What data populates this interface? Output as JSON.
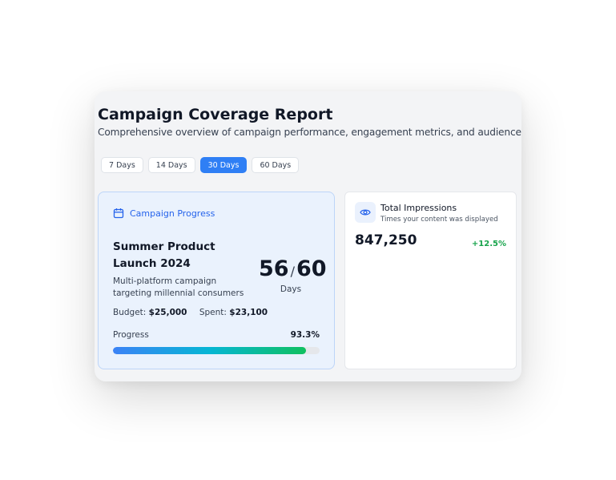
{
  "header": {
    "title": "Campaign Coverage Report",
    "subtitle": "Comprehensive overview of campaign performance, engagement metrics, and audience insights."
  },
  "range_tabs": [
    {
      "label": "7 Days",
      "active": false
    },
    {
      "label": "14 Days",
      "active": false
    },
    {
      "label": "30 Days",
      "active": true
    },
    {
      "label": "60 Days",
      "active": false
    }
  ],
  "campaign_progress": {
    "section_label": "Campaign Progress",
    "icon": "calendar-icon",
    "campaign_name": "Summer Product Launch 2024",
    "description": "Multi-platform campaign targeting millennial consumers",
    "budget_label": "Budget:",
    "budget_value": "$25,000",
    "spent_label": "Spent:",
    "spent_value": "$23,100",
    "days_elapsed": "56",
    "days_separator": "/",
    "days_total": "60",
    "days_label": "Days",
    "progress_label": "Progress",
    "progress_text": "93.3%",
    "progress_fraction": 0.933
  },
  "impressions": {
    "icon": "eye-icon",
    "title": "Total Impressions",
    "subtitle": "Times your content was displayed",
    "value": "847,250",
    "change": "+12.5%"
  },
  "colors": {
    "accent": "#2f7ff5",
    "progress_card_bg": "#eaf2fd",
    "positive": "#16a34a"
  }
}
